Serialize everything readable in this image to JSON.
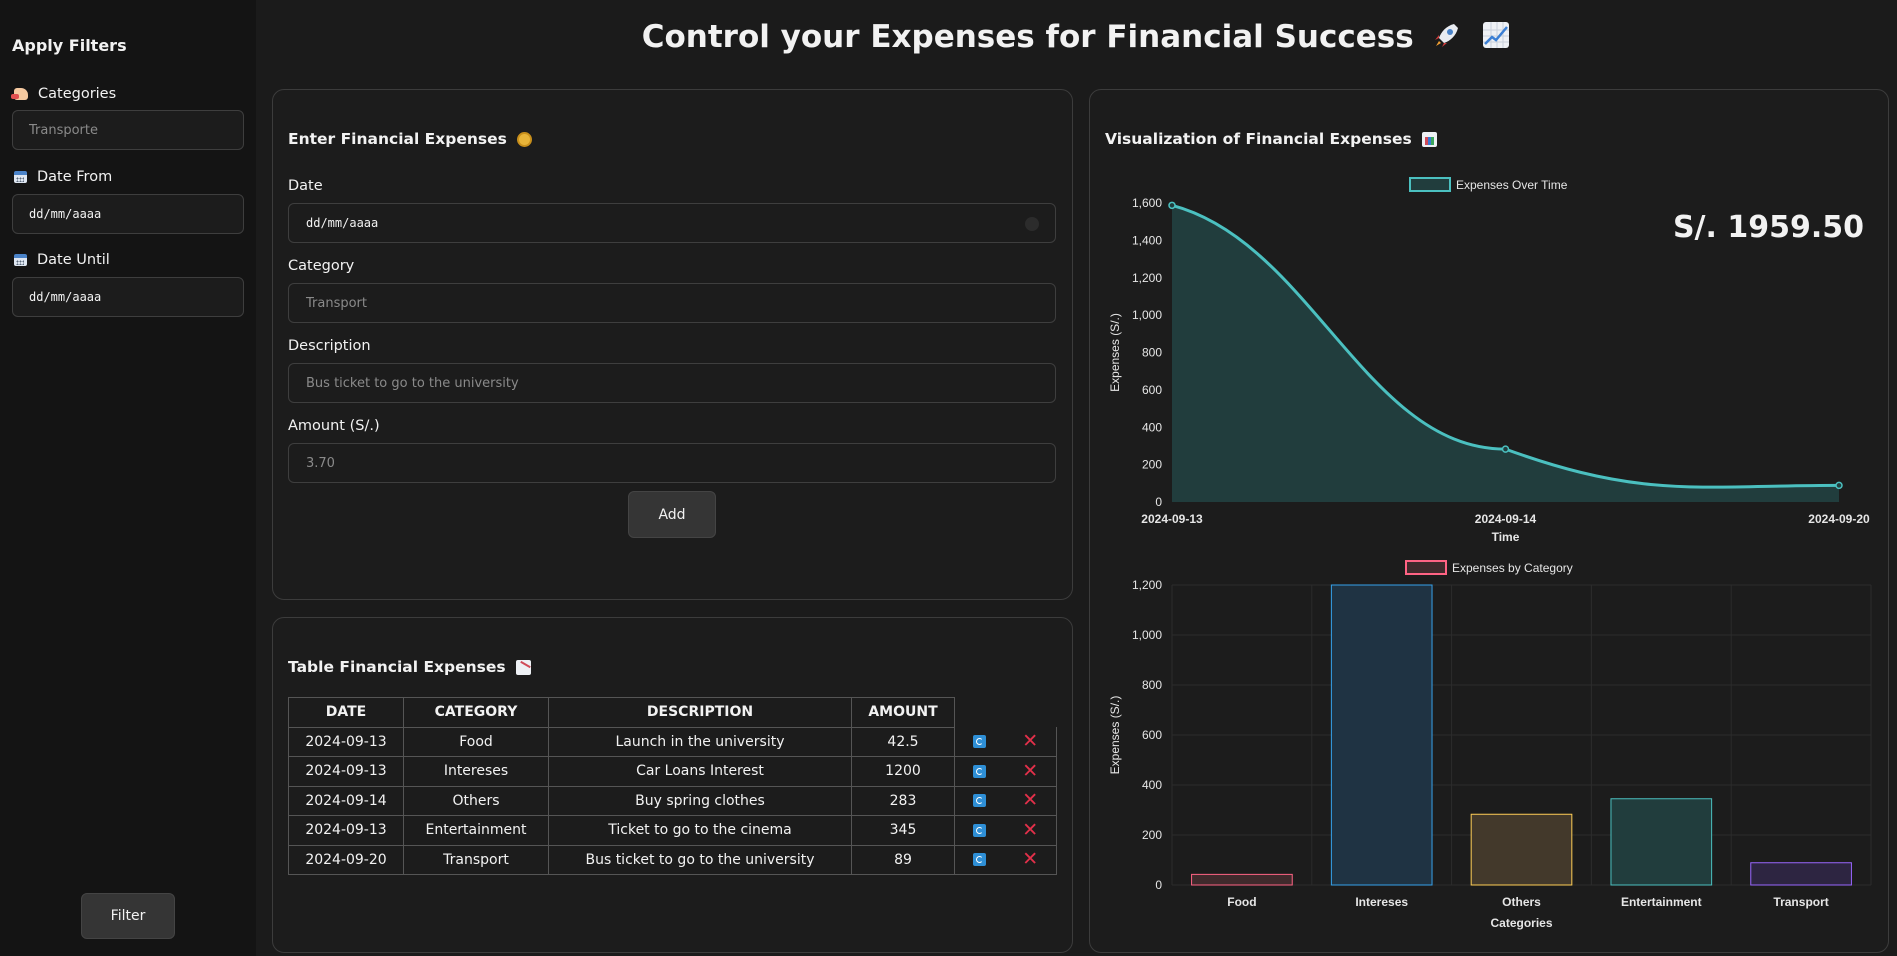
{
  "sidebar": {
    "title": "Apply Filters",
    "categories_label": "Categories",
    "categories_placeholder": "Transporte",
    "date_from_label": "Date From",
    "date_from_value": "dd/mm/aaaa",
    "date_until_label": "Date Until",
    "date_until_value": "dd/mm/aaaa",
    "filter_button": "Filter"
  },
  "header": {
    "title": "Control your Expenses for Financial Success"
  },
  "form": {
    "title": "Enter Financial Expenses",
    "date_label": "Date",
    "date_value": "dd/mm/aaaa",
    "category_label": "Category",
    "category_placeholder": "Transport",
    "description_label": "Description",
    "description_placeholder": "Bus ticket to go to the university",
    "amount_label": "Amount (S/.)",
    "amount_placeholder": "3.70",
    "add_button": "Add"
  },
  "table": {
    "title": "Table Financial Expenses",
    "headers": [
      "DATE",
      "CATEGORY",
      "DESCRIPTION",
      "AMOUNT"
    ],
    "rows": [
      {
        "date": "2024-09-13",
        "category": "Food",
        "description": "Launch in the university",
        "amount": "42.5"
      },
      {
        "date": "2024-09-13",
        "category": "Intereses",
        "description": "Car Loans Interest",
        "amount": "1200"
      },
      {
        "date": "2024-09-14",
        "category": "Others",
        "description": "Buy spring clothes",
        "amount": "283"
      },
      {
        "date": "2024-09-13",
        "category": "Entertainment",
        "description": "Ticket to go to the cinema",
        "amount": "345"
      },
      {
        "date": "2024-09-20",
        "category": "Transport",
        "description": "Bus ticket to go to the university",
        "amount": "89"
      }
    ]
  },
  "visualization": {
    "title": "Visualization of Financial Expenses",
    "total": "S/. 1959.50"
  },
  "colors": {
    "line": "#4bc0c0",
    "line_fill": "#213d3d",
    "danger": "#e2304a",
    "update": "#2e8fd6"
  },
  "chart_data": [
    {
      "type": "area",
      "legend": "Expenses Over Time",
      "legend_position": "top",
      "xlabel": "Time",
      "ylabel": "Expenses (S/.)",
      "x": [
        "2024-09-13",
        "2024-09-14",
        "2024-09-20"
      ],
      "series": [
        {
          "name": "Expenses Over Time",
          "values": [
            1587.5,
            283,
            89
          ]
        }
      ],
      "ylim": [
        0,
        1600
      ],
      "yticks": [
        0,
        200,
        400,
        600,
        800,
        1000,
        1200,
        1400,
        1600
      ],
      "ytick_labels": [
        "0",
        "200",
        "400",
        "600",
        "800",
        "1,000",
        "1,200",
        "1,400",
        "1,600"
      ],
      "grid": false
    },
    {
      "type": "bar",
      "legend": "Expenses by Category",
      "legend_position": "top",
      "xlabel": "Categories",
      "ylabel": "Expenses (S/.)",
      "categories": [
        "Food",
        "Intereses",
        "Others",
        "Entertainment",
        "Transport"
      ],
      "values": [
        42.5,
        1200,
        283,
        345,
        89
      ],
      "ylim": [
        0,
        1200
      ],
      "yticks": [
        0,
        200,
        400,
        600,
        800,
        1000,
        1200
      ],
      "ytick_labels": [
        "0",
        "200",
        "400",
        "600",
        "800",
        "1,000",
        "1,200"
      ],
      "bar_colors": [
        {
          "fill": "#3f2a2c",
          "stroke": "#ff6384"
        },
        {
          "fill": "#1f3343",
          "stroke": "#36a2eb"
        },
        {
          "fill": "#43392b",
          "stroke": "#ffce56"
        },
        {
          "fill": "#213d3d",
          "stroke": "#4bc0c0"
        },
        {
          "fill": "#2d2541",
          "stroke": "#9966ff"
        }
      ],
      "grid": true
    }
  ]
}
